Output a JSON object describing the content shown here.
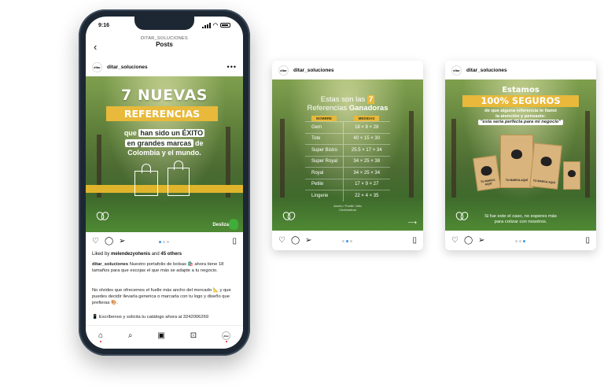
{
  "phone": {
    "time": "9:16",
    "header": {
      "account": "DITAR_SOLUCIONES",
      "title": "Posts"
    },
    "post": {
      "user": "ditar_soluciones",
      "avatar_text": "ditar",
      "headline": "7 NUEVAS",
      "headline_box": "REFERENCIAS",
      "sub_1": "que",
      "sub_hl_1": "han sido un ÉXITO",
      "sub_hl_2": "en grandes marcas",
      "sub_2": "de",
      "sub_3": "Colombia y el mundo.",
      "swipe_label": "Desliza",
      "liked_by_prefix": "Liked by",
      "liked_by_user": "melendezyohenis",
      "liked_by_middle": "and",
      "liked_by_count": "45 others",
      "caption_user": "ditar_soluciones",
      "caption_1": "Nuestro portafolio de bolsas 🛍️ ahora tiene 18 tamaños para que escojas el que más se adapte a tu negocio.",
      "caption_2": "No olvides que ofrecemos el fuelle más ancho del mercado 📐 y que puedes decidir llevarla generica o marcarla con tu logo y diseño que prefieras 🎨.",
      "caption_3": "📱 Escríbenos y solicita tu catálogo ahora al 3242006269"
    },
    "nav": {
      "profile_text": "ditar"
    }
  },
  "card1": {
    "user": "ditar_soluciones",
    "avatar_text": "ditar",
    "title_1": "Estas son las",
    "title_badge": "7",
    "title_2": "Referencias",
    "title_3": "Ganadoras",
    "col_name": "NOMBRE",
    "col_measures": "MEDIDAS",
    "rows": [
      {
        "name": "Gem",
        "size": "18 × 8 × 28"
      },
      {
        "name": "Tote",
        "size": "40 × 15 × 30"
      },
      {
        "name": "Super Bistro",
        "size": "25.5 × 17 × 34"
      },
      {
        "name": "Super Royal",
        "size": "34 × 25 × 38"
      },
      {
        "name": "Royal",
        "size": "34 × 25 × 34"
      },
      {
        "name": "Petite",
        "size": "17 × 9 × 27"
      },
      {
        "name": "Lingerie",
        "size": "22 × 4 × 35"
      }
    ],
    "note_1": "Ancho / Fuelle / Alto",
    "note_2": "Centímetros"
  },
  "card2": {
    "user": "ditar_soluciones",
    "avatar_text": "ditar",
    "estamos": "Estamos",
    "seguros": "100% SEGUROS",
    "sub_1": "de que alguna referencia te llamó",
    "sub_2": "la atención y pensaste:",
    "quote": "\"esta sería perfecta para mi negocio\"",
    "bag_text": "TU MARCA AQUÍ",
    "footer_1": "Si fue este el caso, no esperes más",
    "footer_2": "para cotizar con nosotros."
  },
  "colors": {
    "accent_yellow": "#e8b93a",
    "forest_green": "#4b6b32",
    "pager_active": "#3897f0",
    "phone_frame": "#1c2733"
  },
  "icons": [
    "heart-icon",
    "comment-icon",
    "share-icon",
    "bookmark-icon",
    "home-icon",
    "search-icon",
    "reels-icon",
    "shop-icon",
    "back-icon",
    "more-icon"
  ]
}
